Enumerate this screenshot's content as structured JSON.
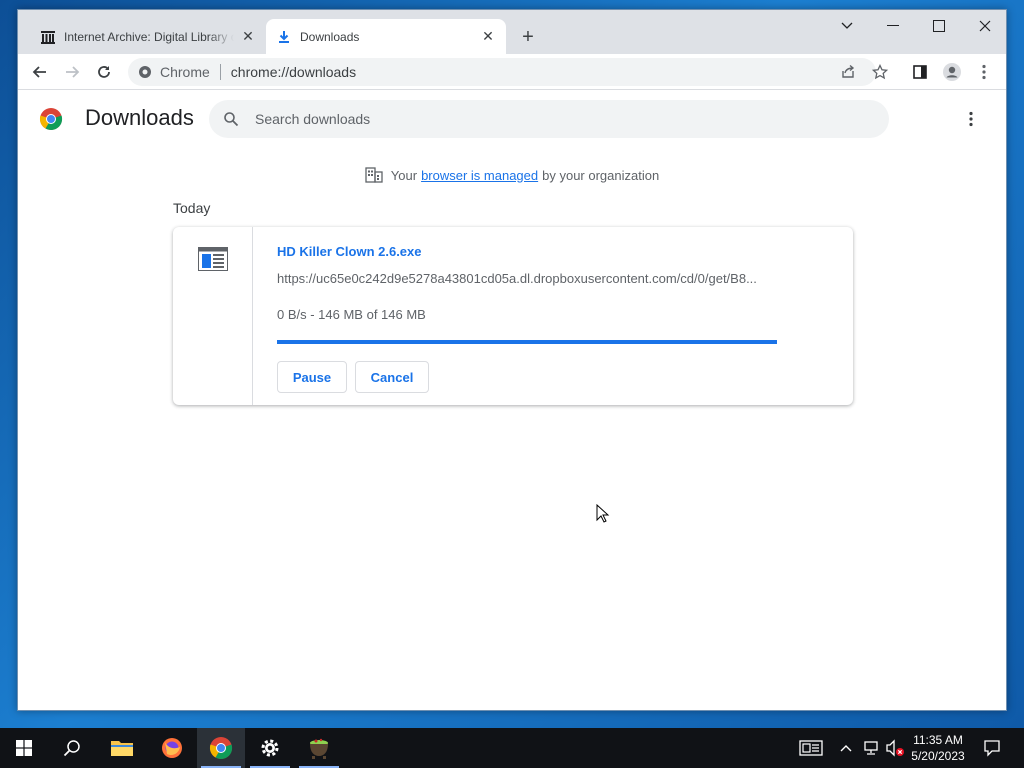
{
  "browser": {
    "tabs": [
      {
        "title": "Internet Archive: Digital Library of Free & Borrowable Books",
        "icon": "archive-building-icon"
      },
      {
        "title": "Downloads",
        "icon": "download-arrow-icon"
      }
    ],
    "omnibox": {
      "site_chip": "Chrome",
      "url": "chrome://downloads"
    }
  },
  "downloads_page": {
    "title": "Downloads",
    "search_placeholder": "Search downloads",
    "managed_notice": {
      "prefix": "Your",
      "link": "browser is managed",
      "suffix": "by your organization"
    },
    "date_heading": "Today",
    "items": [
      {
        "file_name": "HD Killer Clown 2.6.exe",
        "url": "https://uc65e0c242d9e5278a43801cd05a.dl.dropboxusercontent.com/cd/0/get/B8...",
        "status": "0 B/s - 146 MB of 146 MB",
        "progress_fraction": 1.0,
        "pause_label": "Pause",
        "cancel_label": "Cancel"
      }
    ]
  },
  "taskbar": {
    "apps": [
      "start-icon",
      "search-icon",
      "file-explorer-icon",
      "firefox-icon",
      "chrome-icon",
      "settings-icon",
      "cauldron-app-icon"
    ],
    "time": "11:35 AM",
    "date": "5/20/2023"
  },
  "colors": {
    "accent": "#1a73e8",
    "tabstrip": "#dee1e6",
    "taskbar": "#101216"
  }
}
